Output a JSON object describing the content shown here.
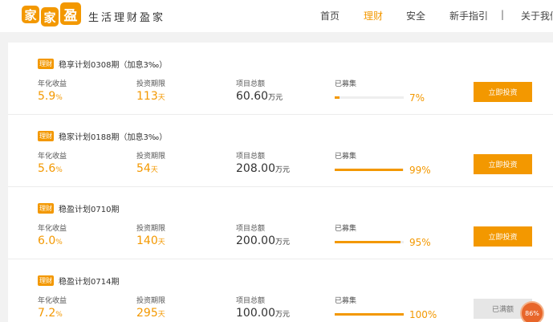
{
  "logo": {
    "chars": [
      "家",
      "家",
      "盈"
    ]
  },
  "header": {
    "slogan": "生活理财盈家"
  },
  "nav": {
    "items": [
      "首页",
      "理财",
      "安全",
      "新手指引"
    ],
    "separator": "|",
    "about": "关于我们"
  },
  "labels": {
    "rate": "年化收益",
    "period": "投资期限",
    "amount": "项目总额",
    "raised": "已募集"
  },
  "units": {
    "rate": "%",
    "period": "天",
    "amount": "万元",
    "percent": "%"
  },
  "products": [
    {
      "tag": "理财",
      "title": "稳享计划0308期（加息3‰）",
      "rate": "5.9",
      "period": "113",
      "amount": "60.60",
      "raised": 7,
      "raised_label": "7",
      "button": "立即投资",
      "status": "active"
    },
    {
      "tag": "理财",
      "title": "稳家计划0188期（加息3‰）",
      "rate": "5.6",
      "period": "54",
      "amount": "208.00",
      "raised": 99,
      "raised_label": "99",
      "button": "立即投资",
      "status": "active"
    },
    {
      "tag": "理财",
      "title": "稳盈计划0710期",
      "rate": "6.0",
      "period": "140",
      "amount": "200.00",
      "raised": 95,
      "raised_label": "95",
      "button": "立即投资",
      "status": "active"
    },
    {
      "tag": "理财",
      "title": "稳盈计划0714期",
      "rate": "7.2",
      "period": "295",
      "amount": "100.00",
      "raised": 100,
      "raised_label": "100",
      "button": "已满额",
      "status": "full"
    }
  ],
  "floating_badge": "86%",
  "colors": {
    "accent": "#f39800",
    "badge": "#e8662a"
  }
}
